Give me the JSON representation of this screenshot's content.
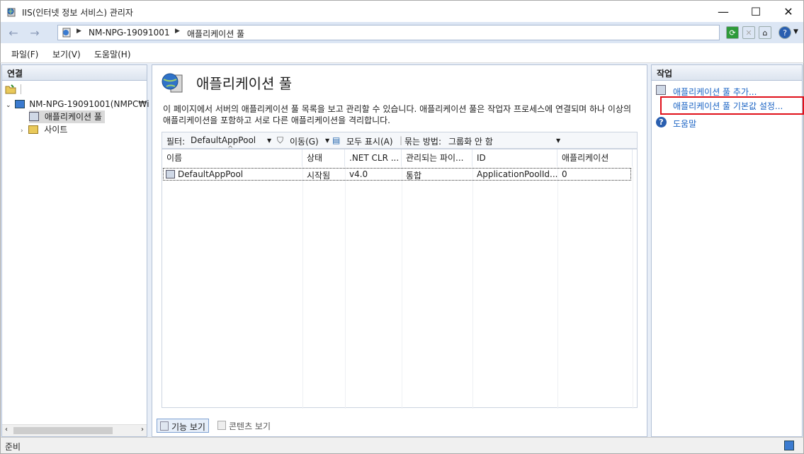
{
  "window": {
    "title": "IIS(인터넷 정보 서비스) 관리자",
    "minimize": "—",
    "maximize": "☐",
    "close": "✕"
  },
  "address": {
    "segments": [
      "NM-NPG-19091001",
      "애플리케이션 풀"
    ],
    "back_icon": "back-arrow-icon",
    "forward_icon": "forward-arrow-icon"
  },
  "menu": [
    {
      "label": "파일(F)"
    },
    {
      "label": "보기(V)"
    },
    {
      "label": "도움말(H)"
    }
  ],
  "connections": {
    "header": "연결",
    "tree": [
      {
        "label": "NM-NPG-19091001(NMPC₩i",
        "level": 0
      },
      {
        "label": "애플리케이션 풀",
        "level": 1
      },
      {
        "label": "사이트",
        "level": 1
      }
    ]
  },
  "main": {
    "title": "애플리케이션 풀",
    "description": "이 페이지에서 서버의 애플리케이션 풀 목록을 보고 관리할 수 있습니다. 애플리케이션 풀은 작업자 프로세스에 연결되며 하나 이상의 애플리케이션을 포함하고 서로 다른 애플리케이션을 격리합니다.",
    "filter": {
      "label": "필터:",
      "value": "DefaultAppPool",
      "go": "이동(G)",
      "show_all": "모두 표시(A)",
      "group_label": "묶는 방법:",
      "group_value": "그룹화 안 함"
    },
    "columns": [
      "이름",
      "상태",
      ".NET CLR ...",
      "관리되는 파이...",
      "ID",
      "애플리케이션"
    ],
    "rows": [
      [
        "DefaultAppPool",
        "시작됨",
        "v4.0",
        "통합",
        "ApplicationPoolId...",
        "0"
      ]
    ],
    "view_tabs": [
      "기능 보기",
      "콘텐츠 보기"
    ]
  },
  "actions": {
    "header": "작업",
    "items": [
      {
        "label": "애플리케이션 풀 추가..."
      },
      {
        "label": "애플리케이션 풀 기본값 설정..."
      },
      {
        "label": "도움말"
      }
    ]
  },
  "status": {
    "text": "준비"
  },
  "colors": {
    "highlight": "#e0101a",
    "link": "#1a63c4"
  }
}
